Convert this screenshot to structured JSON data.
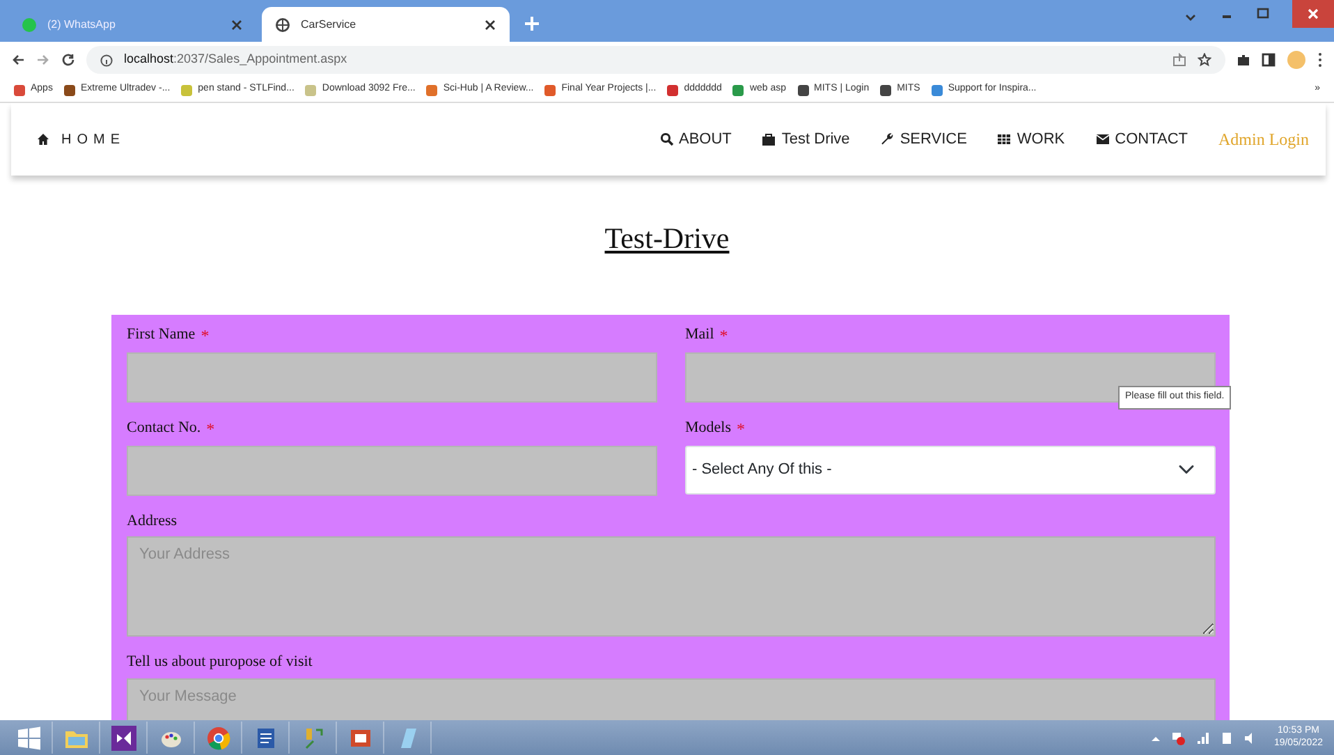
{
  "browser": {
    "tabs": [
      {
        "title": "(2) WhatsApp",
        "selected": false
      },
      {
        "title": "CarService",
        "selected": true
      }
    ],
    "address": {
      "host": "localhost",
      "path": ":2037/Sales_Appointment.aspx"
    },
    "bookmarks": [
      {
        "label": "Apps",
        "color": "#d94a3a"
      },
      {
        "label": "Extreme Ultradev -...",
        "color": "#8a4a1a"
      },
      {
        "label": "pen stand - STLFind...",
        "color": "#c8c23a"
      },
      {
        "label": "Download 3092 Fre...",
        "color": "#c9c38a"
      },
      {
        "label": "Sci-Hub | A Review...",
        "color": "#e0702a"
      },
      {
        "label": "Final Year Projects |...",
        "color": "#e05a2a"
      },
      {
        "label": "ddddddd",
        "color": "#d23030"
      },
      {
        "label": "web asp",
        "color": "#2a9a4a"
      },
      {
        "label": "MITS | Login",
        "color": "#444444"
      },
      {
        "label": "MITS",
        "color": "#444444"
      },
      {
        "label": "Support for Inspira...",
        "color": "#3a8ad8"
      }
    ],
    "bookmarks_more": "»"
  },
  "nav": {
    "brand": "HOME",
    "items": [
      {
        "label": "ABOUT"
      },
      {
        "label": "Test Drive"
      },
      {
        "label": "SERVICE"
      },
      {
        "label": "WORK"
      },
      {
        "label": "CONTACT"
      }
    ],
    "admin": "Admin Login"
  },
  "title": "Test-Drive",
  "form": {
    "fields": [
      {
        "label": "First Name",
        "required": true,
        "kind": "input"
      },
      {
        "label": "Mail",
        "required": true,
        "kind": "input"
      },
      {
        "label": "Contact No.",
        "required": true,
        "kind": "input"
      },
      {
        "label": "Models",
        "required": true,
        "kind": "select",
        "value": "- Select Any Of this -"
      },
      {
        "label": "Address",
        "required": false,
        "kind": "textarea",
        "placeholder": "Your Address"
      },
      {
        "label": "Tell us about puropose of visit",
        "required": false,
        "kind": "textarea",
        "placeholder": "Your Message"
      }
    ],
    "required_mark": "*",
    "tooltip": "Please fill out this field."
  },
  "taskbar": {
    "time": "10:53 PM",
    "date": "19/05/2022"
  }
}
